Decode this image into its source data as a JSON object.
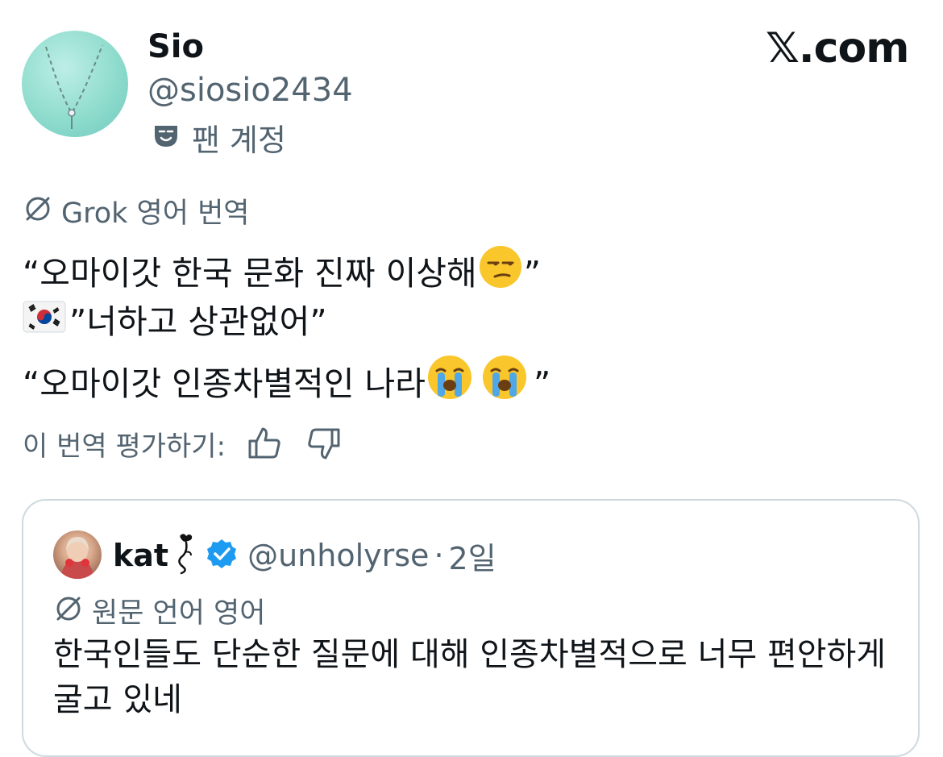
{
  "author": {
    "display_name": "Sio",
    "handle": "@siosio2434",
    "account_label": "팬 계정",
    "avatar_icon": "necklace-avatar"
  },
  "brand": {
    "text": "𝕏.com"
  },
  "translation": {
    "source_label": "Grok 영어 번역",
    "lines": {
      "l1": "“오마이갓 한국 문화 진짜 이상해 ",
      "l1_end": "”",
      "l2": "”너하고 상관없어”",
      "l3": "“오마이갓 인종차별적인 나라",
      "l3_end": "”"
    },
    "rate_label": "이 번역 평가하기:"
  },
  "quote": {
    "display_name": "kat",
    "handle": "@unholyrse",
    "separator": "·",
    "time": "2일",
    "original_language_label": "원문 언어 영어",
    "text": "한국인들도 단순한 질문에 대해 인종차별적으로 너무 편안하게 굴고 있네",
    "verified_color": "#1d9bf0"
  },
  "colors": {
    "text": "#0f1419",
    "secondary": "#536471",
    "border": "#cfd9de"
  }
}
